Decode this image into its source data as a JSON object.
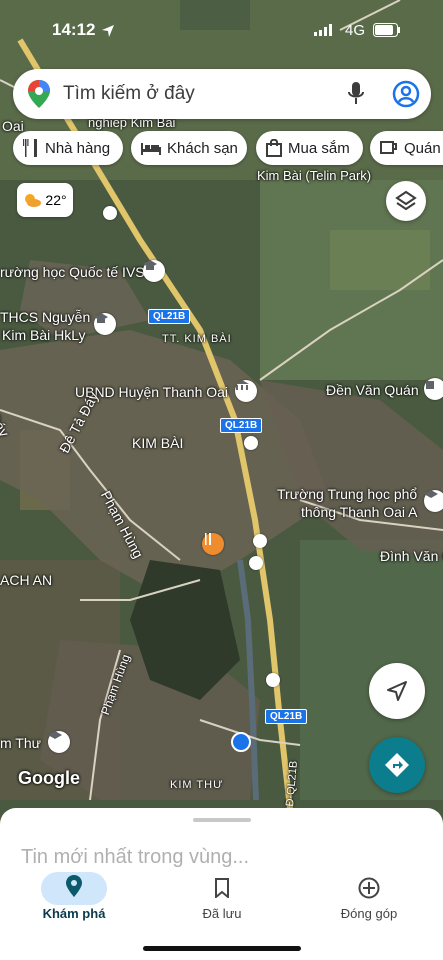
{
  "status_bar": {
    "time": "14:12",
    "network": "4G"
  },
  "search": {
    "placeholder": "Tìm kiếm ở đây"
  },
  "chips": [
    "Nhà hàng",
    "Khách sạn",
    "Mua sắm",
    "Quán"
  ],
  "weather": {
    "temp": "22°",
    "icon": "partly-cloudy-icon"
  },
  "map_labels": {
    "nghiep": "nghiep Kim Bai",
    "telin": "Kim Bài (Telin Park)",
    "ivs": "rường học Quốc tế IVS",
    "thcs1": "THCS Nguyễn",
    "thcs2": "Kim Bài HkLy",
    "tt_kim_bai": "TT. KIM BÀI",
    "ubnd": "UBND Huyện Thanh Oai",
    "den_van_quan": "Đền Văn Quán",
    "day": "Đáy",
    "de_ta_day": "Đê Tả Đáy",
    "kim_bai": "KIM BÀI",
    "pham_hung1": "Phạm Hùng",
    "truong1": "Trường Trung học phổ",
    "truong2": "thông Thanh Oai A",
    "dinh_van": "Đình Văn C",
    "lach_an": "ACH AN",
    "pham_hung2": "Phạm Hùng",
    "m_thu": "m Thư",
    "kim_thu": "KIM THƯ",
    "dt_ql21b": "Đ-QL21B",
    "oai": "Oai",
    "google": "Google"
  },
  "road_shields": [
    "QL21B",
    "QL21B",
    "QL21B"
  ],
  "bottom_sheet": {
    "title": "Tin mới nhất trong vùng..."
  },
  "nav": {
    "items": [
      {
        "label": "Khám phá",
        "icon": "location-pin-icon",
        "active": true
      },
      {
        "label": "Đã lưu",
        "icon": "bookmark-icon",
        "active": false
      },
      {
        "label": "Đóng góp",
        "icon": "add-circle-icon",
        "active": false
      }
    ]
  },
  "colors": {
    "accent": "#1a73e8",
    "directions": "#0b7d8c",
    "nav_active_bg": "#cfe6fb"
  }
}
